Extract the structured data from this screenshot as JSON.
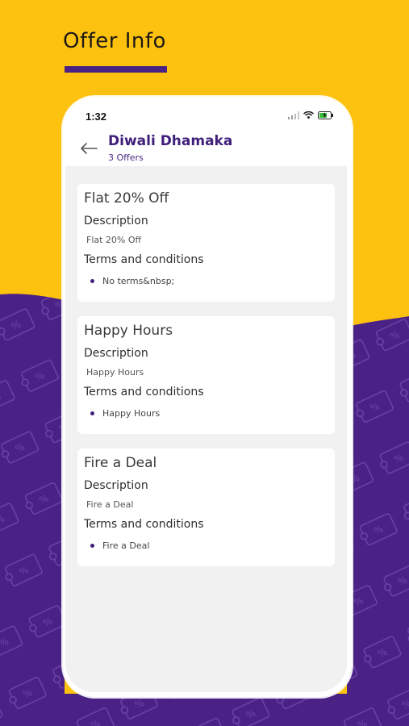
{
  "promo": {
    "title": "Offer Info"
  },
  "status_bar": {
    "time": "1:32"
  },
  "header": {
    "title": "Diwali Dhamaka",
    "subtitle": "3 Offers"
  },
  "labels": {
    "description": "Description",
    "terms": "Terms and conditions"
  },
  "offers": [
    {
      "title": "Flat 20% Off",
      "description": "Flat 20% Off",
      "term": "No terms&nbsp;"
    },
    {
      "title": "Happy Hours",
      "description": "Happy Hours",
      "term": "Happy Hours"
    },
    {
      "title": "Fire a Deal",
      "description": "Fire a Deal",
      "term": "Fire a Deal"
    }
  ],
  "colors": {
    "yellow": "#fdc20f",
    "purple": "#4a2185",
    "dark_purple": "#3f1f7a"
  }
}
